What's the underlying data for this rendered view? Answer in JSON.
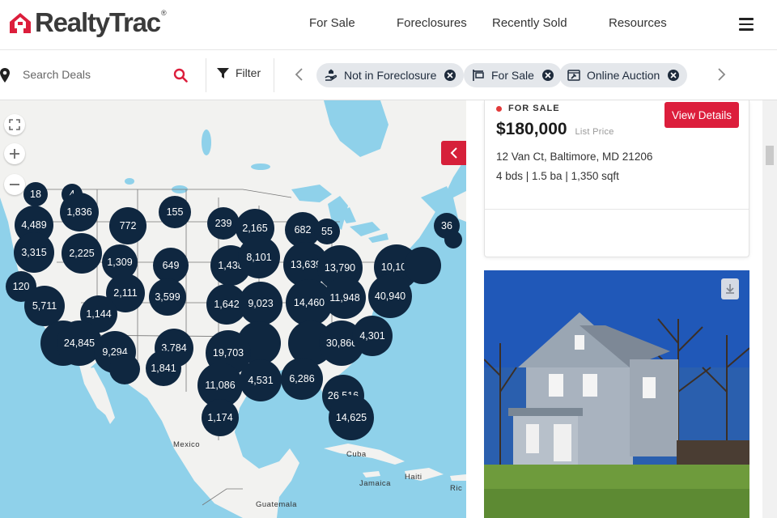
{
  "header": {
    "logo_text": "RealtyTrac",
    "logo_reg": "®",
    "nav": [
      "For Sale",
      "Foreclosures",
      "Recently Sold",
      "Resources"
    ]
  },
  "filterbar": {
    "search_placeholder": "Search Deals",
    "filter_label": "Filter",
    "chips": [
      {
        "label": "Not in Foreclosure",
        "icon": "hand-house-icon"
      },
      {
        "label": "For Sale",
        "icon": "sign-icon"
      },
      {
        "label": "Online Auction",
        "icon": "auction-screen-icon"
      }
    ]
  },
  "map": {
    "controls": [
      "expand-icon",
      "zoom-in-icon",
      "zoom-out-icon"
    ],
    "clusters": [
      "18",
      "4",
      "1,836",
      "155",
      "4,489",
      "772",
      "239",
      "2,165",
      "682",
      "55",
      "36",
      "3,315",
      "2,225",
      "1,309",
      "649",
      "1,438",
      "8,101",
      "13,639",
      "13,790",
      "10,107",
      "120",
      "2,111",
      "3,599",
      "1,642",
      "9,023",
      "14,460",
      "11,948",
      "40,940",
      "5,711",
      "1,144",
      "24,845",
      "9,294",
      "3,784",
      "19,703",
      "30,866",
      "4,301",
      "1,841",
      "11,086",
      "4,531",
      "6,286",
      "26,516",
      "1,174",
      "14,625"
    ],
    "labels": {
      "mexico": "Mexico",
      "cuba": "Cuba",
      "jamaica": "Jamaica",
      "haiti": "Haiti",
      "guatemala": "Guatemala",
      "rico": "Ric"
    }
  },
  "listing": {
    "status": "FOR SALE",
    "price": "$180,000",
    "price_label": "List Price",
    "address": "12 Van Ct, Baltimore, MD 21206",
    "specs": "4 bds | 1.5 ba | 1,350 sqft",
    "view_button": "View Details"
  },
  "colors": {
    "brand_red": "#dc1e3c",
    "cluster_navy": "#0f2740",
    "water": "#8fd1ea",
    "land": "#f2f2f0"
  }
}
